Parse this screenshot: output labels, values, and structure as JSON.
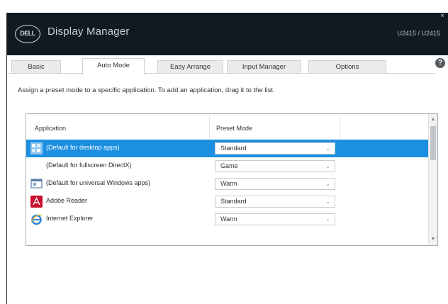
{
  "window": {
    "title": "Display Manager",
    "logo_text": "DELL",
    "model": "U2415 / U2415",
    "close_glyph": "×"
  },
  "tabs": [
    {
      "label": "Basic"
    },
    {
      "label": "Auto Mode",
      "active": true
    },
    {
      "label": "Easy Arrange"
    },
    {
      "label": "Input Manager"
    },
    {
      "label": "Options"
    }
  ],
  "help_glyph": "?",
  "instruction": "Assign a preset mode to a specific application. To add an application, drag it to the list.",
  "table": {
    "columns": [
      "Application",
      "Preset Mode"
    ],
    "rows": [
      {
        "name": "(Default for desktop apps)",
        "mode": "Standard",
        "icon": "desktop-apps-icon",
        "selected": true
      },
      {
        "name": "(Default for fullscreen DirectX)",
        "mode": "Game",
        "icon": "none"
      },
      {
        "name": "(Default for universal Windows apps)",
        "mode": "Warm",
        "icon": "windows-app-icon"
      },
      {
        "name": "Adobe Reader",
        "mode": "Standard",
        "icon": "adobe-reader-icon"
      },
      {
        "name": "Internet Explorer",
        "mode": "Warm",
        "icon": "internet-explorer-icon"
      }
    ]
  },
  "colors": {
    "titlebar": "#101a20",
    "selection": "#1c8fe1",
    "adobe_red": "#c8102e",
    "ie_blue": "#2f86d4"
  }
}
